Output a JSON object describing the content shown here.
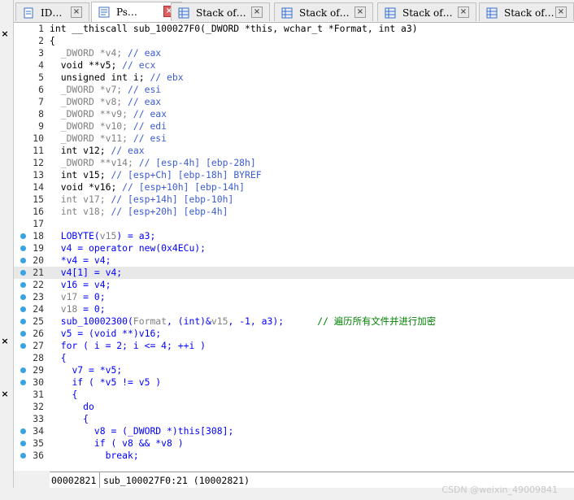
{
  "tabs": [
    {
      "label": "ID…",
      "icon": "document-icon",
      "active": false
    },
    {
      "label": "Ps…",
      "icon": "pseudocode-icon",
      "active": true
    },
    {
      "label": "Stack of…",
      "icon": "stack-icon",
      "active": false
    },
    {
      "label": "Stack of…",
      "icon": "stack-icon",
      "active": false
    },
    {
      "label": "Stack of…",
      "icon": "stack-icon",
      "active": false
    },
    {
      "label": "Stack of…",
      "icon": "stack-icon",
      "active": false
    }
  ],
  "left_panel": {
    "close_glyph": "×"
  },
  "code_lines": [
    {
      "num": "1",
      "dot": false,
      "html": "<span class='b'>int __thiscall sub_100027F0(_DWORD *this, wchar_t *Format, int a3)</span>",
      "gray": true
    },
    {
      "num": "2",
      "dot": false,
      "html": "<span class='b'>{</span>"
    },
    {
      "num": "3",
      "dot": false,
      "html": "  <span class='g'>_DWORD *v4; </span><span class='c'>// eax</span>"
    },
    {
      "num": "4",
      "dot": false,
      "html": "  <span class='b'>void **v5; </span><span class='c'>// ecx</span>"
    },
    {
      "num": "5",
      "dot": false,
      "html": "  <span class='b'>unsigned int i; </span><span class='c'>// ebx</span>"
    },
    {
      "num": "6",
      "dot": false,
      "html": "  <span class='g'>_DWORD *v7; </span><span class='c'>// esi</span>"
    },
    {
      "num": "7",
      "dot": false,
      "html": "  <span class='g'>_DWORD *v8; </span><span class='c'>// eax</span>"
    },
    {
      "num": "8",
      "dot": false,
      "html": "  <span class='g'>_DWORD **v9; </span><span class='c'>// eax</span>"
    },
    {
      "num": "9",
      "dot": false,
      "html": "  <span class='g'>_DWORD *v10; </span><span class='c'>// edi</span>"
    },
    {
      "num": "10",
      "dot": false,
      "html": "  <span class='g'>_DWORD *v11; </span><span class='c'>// esi</span>"
    },
    {
      "num": "11",
      "dot": false,
      "html": "  <span class='b'>int v12; </span><span class='c'>// eax</span>"
    },
    {
      "num": "12",
      "dot": false,
      "html": "  <span class='g'>_DWORD **v14; </span><span class='c'>// [esp-4h] [ebp-28h]</span>"
    },
    {
      "num": "13",
      "dot": false,
      "html": "  <span class='b'>int v15; </span><span class='c'>// [esp+Ch] [ebp-18h] BYREF</span>"
    },
    {
      "num": "14",
      "dot": false,
      "html": "  <span class='b'>void *v16; </span><span class='c'>// [esp+10h] [ebp-14h]</span>"
    },
    {
      "num": "15",
      "dot": false,
      "html": "  <span class='g'>int v17; </span><span class='c'>// [esp+14h] [ebp-10h]</span>"
    },
    {
      "num": "16",
      "dot": false,
      "html": "  <span class='g'>int v18; </span><span class='c'>// [esp+20h] [ebp-4h]</span>"
    },
    {
      "num": "17",
      "dot": false,
      "html": ""
    },
    {
      "num": "18",
      "dot": true,
      "html": "  <span class='k'>LOBYTE(</span><span class='g'>v15</span><span class='k'>) = a3;</span>"
    },
    {
      "num": "19",
      "dot": true,
      "html": "  <span class='k'>v4 = operator new(0x4ECu);</span>"
    },
    {
      "num": "20",
      "dot": true,
      "html": "  <span class='k'>*v4 = v4;</span>"
    },
    {
      "num": "21",
      "dot": true,
      "hl": true,
      "html": "  <span class='k'>v4[1] = v4;</span>"
    },
    {
      "num": "22",
      "dot": true,
      "html": "  <span class='k'>v16 = v4;</span>"
    },
    {
      "num": "23",
      "dot": true,
      "html": "  <span class='g'>v17</span><span class='k'> = 0;</span>"
    },
    {
      "num": "24",
      "dot": true,
      "html": "  <span class='g'>v18</span><span class='k'> = 0;</span>"
    },
    {
      "num": "25",
      "dot": true,
      "html": "  <span class='k'>sub_10002300(</span><span class='g'>Format</span><span class='k'>, (int)&amp;</span><span class='g'>v15</span><span class='k'>, -1, a3);</span>      <span class='z'>// 遍历所有文件并进行加密</span>"
    },
    {
      "num": "26",
      "dot": true,
      "html": "  <span class='k'>v5 = (void **)v16;</span>"
    },
    {
      "num": "27",
      "dot": true,
      "html": "  <span class='k'>for ( i = 2; i &lt;= 4; ++i )</span>"
    },
    {
      "num": "28",
      "dot": false,
      "html": "  <span class='k'>{</span>"
    },
    {
      "num": "29",
      "dot": true,
      "html": "    <span class='k'>v7 = *v5;</span>"
    },
    {
      "num": "30",
      "dot": true,
      "html": "    <span class='k'>if ( *v5 != v5 )</span>"
    },
    {
      "num": "31",
      "dot": false,
      "html": "    <span class='k'>{</span>"
    },
    {
      "num": "32",
      "dot": false,
      "html": "      <span class='k'>do</span>"
    },
    {
      "num": "33",
      "dot": false,
      "html": "      <span class='k'>{</span>"
    },
    {
      "num": "34",
      "dot": true,
      "html": "        <span class='k'>v8 = (_DWORD *)this[308];</span>"
    },
    {
      "num": "35",
      "dot": true,
      "html": "        <span class='k'>if ( v8 &amp;&amp; *v8 )</span>"
    },
    {
      "num": "36",
      "dot": true,
      "html": "          <span class='k'>break;</span>"
    }
  ],
  "status": {
    "address": "00002821",
    "location": "sub_100027F0:21 (10002821)"
  },
  "watermark": "CSDN @weixin_49009841"
}
